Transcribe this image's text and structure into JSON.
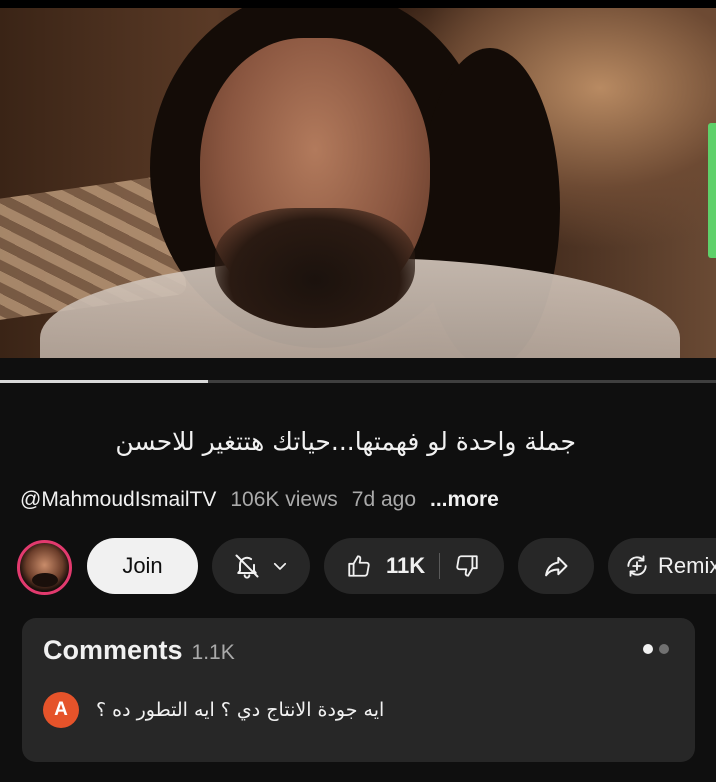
{
  "video": {
    "title": "جملة واحدة لو فهمتها...حياتك هتتغير للاحسن",
    "progress": 0.29
  },
  "meta": {
    "channel": "@MahmoudIsmailTV",
    "views": "106K views",
    "posted": "7d ago",
    "more": "...more"
  },
  "actions": {
    "join_label": "Join",
    "likes_count": "11K",
    "remix_label": "Remix"
  },
  "comments": {
    "label": "Comments",
    "count": "1.1K",
    "top_comment": {
      "author_initial": "A",
      "author_color": "#e5532a",
      "text": "ايه جودة الانتاج دي ؟ ايه التطور ده ؟"
    }
  },
  "icons": {
    "notification": "bell-off-icon",
    "dropdown": "chevron-down-icon",
    "like": "thumbs-up-icon",
    "dislike": "thumbs-down-icon",
    "share": "share-arrow-icon",
    "remix": "remix-icon"
  },
  "colors": {
    "background": "#0f0f0f",
    "pill": "#272727",
    "join_bg": "#f1f1f1",
    "secondary_text": "#aaaaaa"
  }
}
